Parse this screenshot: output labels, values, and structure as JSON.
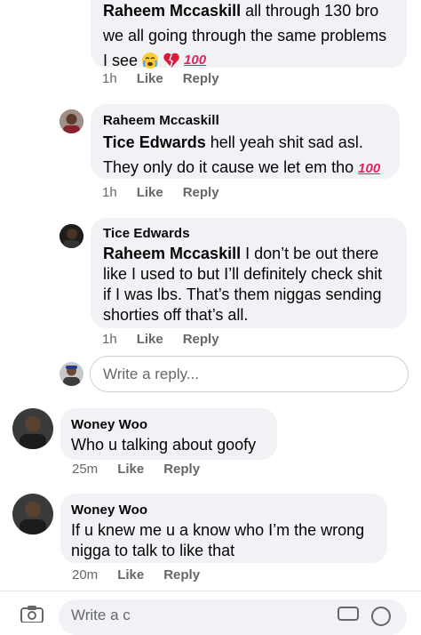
{
  "comment_top": {
    "author_partial": "Raheem Mccaskill",
    "line_partial": "all through 130 bro",
    "line2": "we all going through the same problems",
    "line3": "I see",
    "emojis": [
      "crying-face-icon",
      "broken-heart-icon",
      "hundred-points-icon"
    ],
    "hundred": "100",
    "time": "1h",
    "like": "Like",
    "reply": "Reply"
  },
  "comment_raheem": {
    "author": "Raheem Mccaskill",
    "tag": "Tice Edwards",
    "line1_rest": " hell yeah shit sad asl.",
    "line2": "They only do it cause we let em tho",
    "hundred": "100",
    "time": "1h",
    "like": "Like",
    "reply": "Reply"
  },
  "comment_tice": {
    "author": "Tice Edwards",
    "tag": "Raheem Mccaskill",
    "line1_rest": " I don’t be out there",
    "line2": "like I used to but I’ll definitely check shit",
    "line3": "if I was lbs. That’s them niggas sending",
    "line4": "shorties off that’s all.",
    "time": "1h",
    "like": "Like",
    "reply": "Reply"
  },
  "reply_input": {
    "placeholder": "Write a reply..."
  },
  "comment_woney1": {
    "author": "Woney Woo",
    "text": "Who u talking about goofy",
    "time": "25m",
    "like": "Like",
    "reply": "Reply"
  },
  "comment_woney2": {
    "author": "Woney Woo",
    "line1": "If u knew me u a know who I’m the wrong",
    "line2": "nigga to talk to like that",
    "time": "20m",
    "like": "Like",
    "reply": "Reply"
  },
  "bottom_bar": {
    "placeholder_partial": "Write a c"
  },
  "colors": {
    "bubble": "#f0f2f5",
    "meta": "#65676b",
    "text": "#050505"
  }
}
